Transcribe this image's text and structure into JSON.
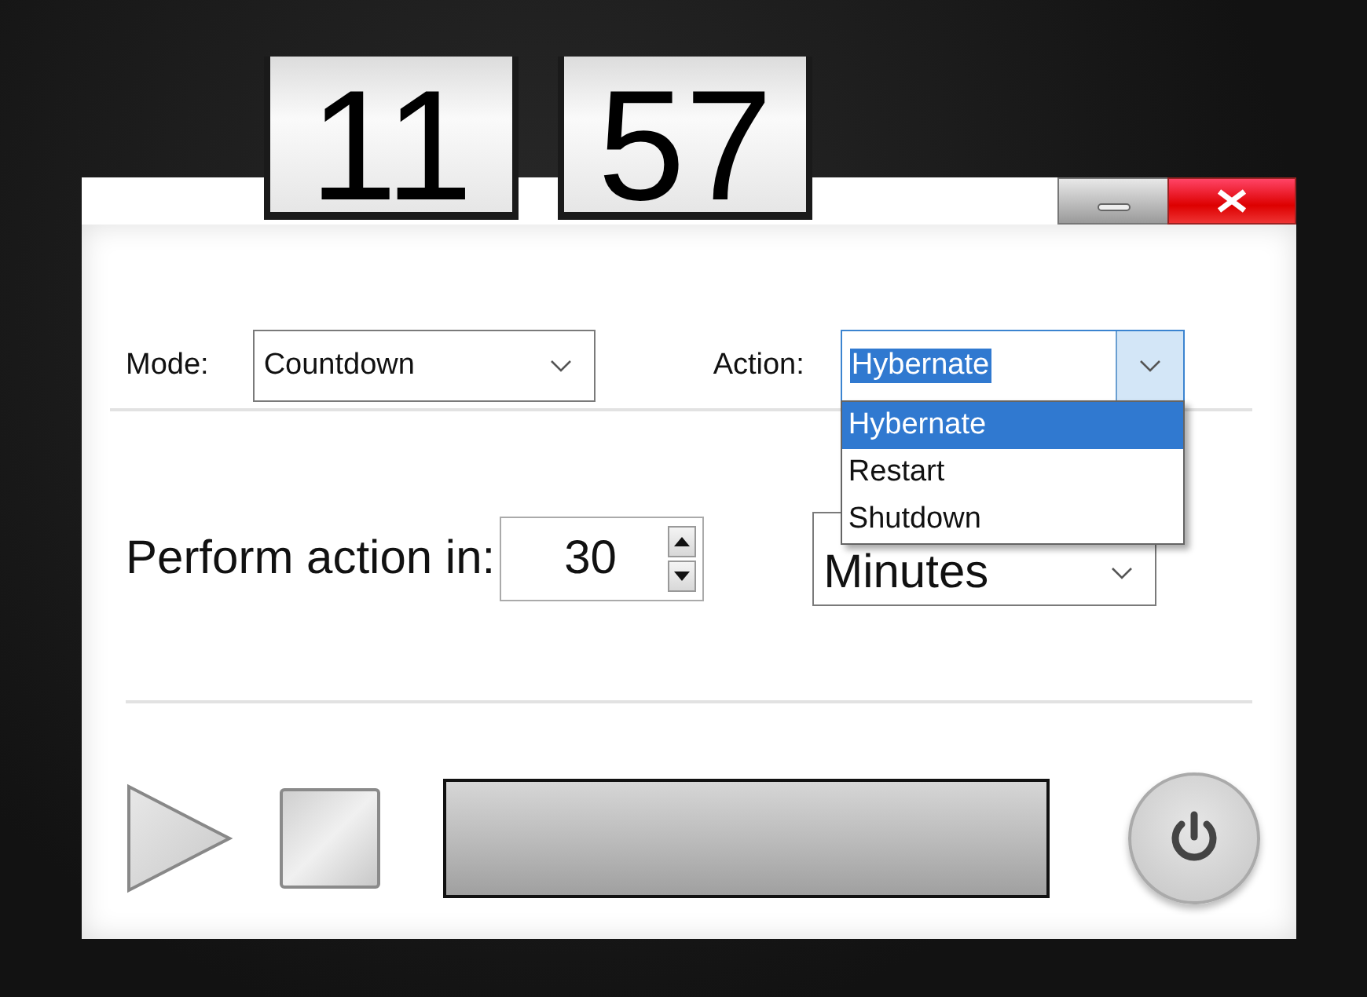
{
  "clock": {
    "hours": "11",
    "minutes": "57"
  },
  "mode": {
    "label": "Mode:",
    "value": "Countdown"
  },
  "action": {
    "label": "Action:",
    "value": "Hybernate",
    "expanded": true,
    "options": [
      {
        "label": "Hybernate",
        "selected": true
      },
      {
        "label": "Restart",
        "selected": false
      },
      {
        "label": "Shutdown",
        "selected": false
      }
    ]
  },
  "delay": {
    "label": "Perform action in:",
    "value": "30",
    "unit": "Minutes"
  },
  "progress": {
    "level": 0
  }
}
